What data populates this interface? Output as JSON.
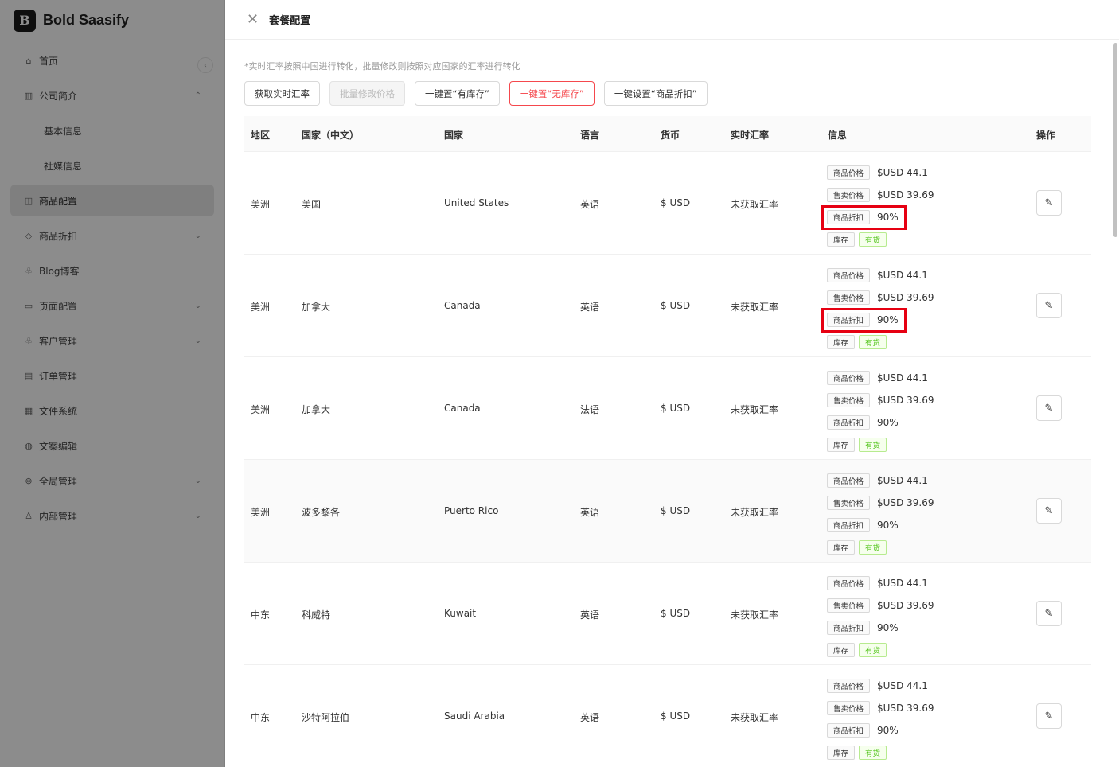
{
  "brand": {
    "name": "Bold Saasify",
    "logo_letter": "B"
  },
  "sidebar": {
    "items": [
      {
        "label": "首页",
        "icon": "home-icon",
        "glyph": "⌂",
        "chevron": "",
        "sub": false,
        "active": false
      },
      {
        "label": "公司简介",
        "icon": "building-icon",
        "glyph": "▥",
        "chevron": "⌃",
        "sub": false,
        "active": false
      },
      {
        "label": "基本信息",
        "icon": "",
        "glyph": "",
        "chevron": "",
        "sub": true,
        "active": false
      },
      {
        "label": "社媒信息",
        "icon": "",
        "glyph": "",
        "chevron": "",
        "sub": true,
        "active": false
      },
      {
        "label": "商品配置",
        "icon": "package-icon",
        "glyph": "◫",
        "chevron": "",
        "sub": false,
        "active": true
      },
      {
        "label": "商品折扣",
        "icon": "tag-icon",
        "glyph": "◇",
        "chevron": "⌄",
        "sub": false,
        "active": false
      },
      {
        "label": "Blog博客",
        "icon": "users-icon",
        "glyph": "♧",
        "chevron": "",
        "sub": false,
        "active": false
      },
      {
        "label": "页面配置",
        "icon": "monitor-icon",
        "glyph": "▭",
        "chevron": "⌄",
        "sub": false,
        "active": false
      },
      {
        "label": "客户管理",
        "icon": "customers-icon",
        "glyph": "♧",
        "chevron": "⌄",
        "sub": false,
        "active": false
      },
      {
        "label": "订单管理",
        "icon": "order-icon",
        "glyph": "▤",
        "chevron": "",
        "sub": false,
        "active": false
      },
      {
        "label": "文件系统",
        "icon": "file-icon",
        "glyph": "▦",
        "chevron": "",
        "sub": false,
        "active": false
      },
      {
        "label": "文案编辑",
        "icon": "globe-icon",
        "glyph": "◍",
        "chevron": "",
        "sub": false,
        "active": false
      },
      {
        "label": "全局管理",
        "icon": "settings-icon",
        "glyph": "⊛",
        "chevron": "⌄",
        "sub": false,
        "active": false
      },
      {
        "label": "内部管理",
        "icon": "user-icon",
        "glyph": "♙",
        "chevron": "⌄",
        "sub": false,
        "active": false
      }
    ]
  },
  "drawer": {
    "title": "套餐配置",
    "note": "*实时汇率按照中国进行转化，批量修改则按照对应国家的汇率进行转化",
    "buttons": {
      "fetch_rate": "获取实时汇率",
      "batch_edit": "批量修改价格",
      "set_in_stock": "一键置“有库存”",
      "set_out_of_stock": "一键置“无库存”",
      "set_discount": "一键设置“商品折扣”"
    }
  },
  "table": {
    "headers": {
      "region": "地区",
      "country_cn": "国家（中文）",
      "country": "国家",
      "language": "语言",
      "currency": "货币",
      "rate": "实时汇率",
      "info": "信息",
      "action": "操作"
    },
    "info_labels": {
      "price": "商品价格",
      "sale_price": "售卖价格",
      "discount": "商品折扣",
      "stock": "库存"
    },
    "rows": [
      {
        "region": "美洲",
        "country_cn": "美国",
        "country": "United States",
        "language": "英语",
        "currency": "$ USD",
        "rate": "未获取汇率",
        "price": "$USD 44.1",
        "sale_price": "$USD 39.69",
        "discount": "90%",
        "stock": "有货"
      },
      {
        "region": "美洲",
        "country_cn": "加拿大",
        "country": "Canada",
        "language": "英语",
        "currency": "$ USD",
        "rate": "未获取汇率",
        "price": "$USD 44.1",
        "sale_price": "$USD 39.69",
        "discount": "90%",
        "stock": "有货"
      },
      {
        "region": "美洲",
        "country_cn": "加拿大",
        "country": "Canada",
        "language": "法语",
        "currency": "$ USD",
        "rate": "未获取汇率",
        "price": "$USD 44.1",
        "sale_price": "$USD 39.69",
        "discount": "90%",
        "stock": "有货"
      },
      {
        "region": "美洲",
        "country_cn": "波多黎各",
        "country": "Puerto Rico",
        "language": "英语",
        "currency": "$ USD",
        "rate": "未获取汇率",
        "price": "$USD 44.1",
        "sale_price": "$USD 39.69",
        "discount": "90%",
        "stock": "有货"
      },
      {
        "region": "中东",
        "country_cn": "科威特",
        "country": "Kuwait",
        "language": "英语",
        "currency": "$ USD",
        "rate": "未获取汇率",
        "price": "$USD 44.1",
        "sale_price": "$USD 39.69",
        "discount": "90%",
        "stock": "有货"
      },
      {
        "region": "中东",
        "country_cn": "沙特阿拉伯",
        "country": "Saudi Arabia",
        "language": "英语",
        "currency": "$ USD",
        "rate": "未获取汇率",
        "price": "$USD 44.1",
        "sale_price": "$USD 39.69",
        "discount": "90%",
        "stock": "有货"
      }
    ]
  },
  "colors": {
    "danger": "#f5484d",
    "highlight": "#e60012",
    "success": "#52c41a"
  }
}
